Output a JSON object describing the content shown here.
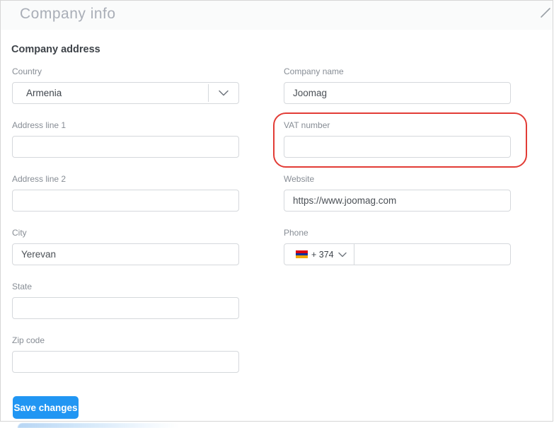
{
  "window": {
    "title": "Company info"
  },
  "section": {
    "title": "Company address"
  },
  "fields": {
    "country": {
      "label": "Country",
      "value": "Armenia"
    },
    "address1": {
      "label": "Address line 1",
      "value": ""
    },
    "address2": {
      "label": "Address line 2",
      "value": ""
    },
    "city": {
      "label": "City",
      "value": "Yerevan"
    },
    "state": {
      "label": "State",
      "value": ""
    },
    "zip": {
      "label": "Zip code",
      "value": ""
    },
    "company_name": {
      "label": "Company name",
      "value": "Joomag"
    },
    "vat": {
      "label": "VAT number",
      "value": ""
    },
    "website": {
      "label": "Website",
      "value": "https://www.joomag.com"
    },
    "phone": {
      "label": "Phone",
      "dial_code": "+ 374",
      "value": ""
    }
  },
  "buttons": {
    "save": "Save changes"
  },
  "icons": {
    "country_chevron": "chevron-down-icon",
    "phone_chevron": "chevron-down-icon",
    "phone_flag": "armenia-flag-icon",
    "corner": "close-icon"
  },
  "colors": {
    "accent_blue": "#2196f3",
    "annotation_red": "#e23c36",
    "flag_red": "#d90012",
    "flag_blue": "#0033a0",
    "flag_orange": "#f2a800"
  },
  "annotation": {
    "target": "VAT number field"
  }
}
